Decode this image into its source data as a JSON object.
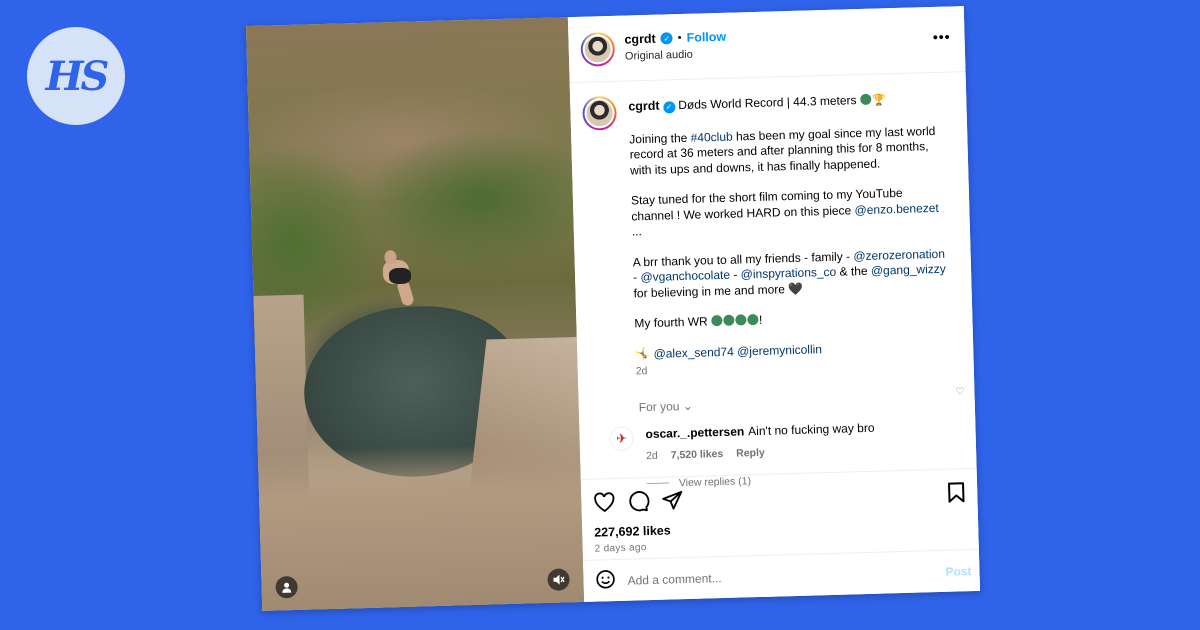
{
  "brand": {
    "logo_text": "HS"
  },
  "post": {
    "username": "cgrdt",
    "follow_label": "Follow",
    "separator": "•",
    "audio": "Original audio",
    "more_label": "•••",
    "caption": {
      "title": "Døds World Record | 44.3 meters",
      "p1_pre": "Joining the ",
      "p1_hashtag": "#40club",
      "p1_post": " has been my goal since my last world record at 36 meters and after planning this for 8 months, with its ups and downs, it has finally happened.",
      "p2_pre": "Stay tuned for the short film coming to my YouTube channel ! We worked HARD on this piece ",
      "p2_mention": "@enzo.benezet",
      "p2_post": " ...",
      "p3_pre": "A brr thank you to all my friends - family - ",
      "p3_m1": "@zerozeronation",
      "p3_sep1": " - ",
      "p3_m2": "@vganchocolate",
      "p3_sep2": " - ",
      "p3_m3": "@inspyrations_co",
      "p3_and": " & the ",
      "p3_m4": "@gang_wizzy",
      "p3_post": " for believing in me and more ",
      "p4_pre": "My fourth WR ",
      "p4_post": "!",
      "tag1": "@alex_send74",
      "tag2": "@jeremynicollin",
      "time": "2d"
    },
    "for_you": "For you",
    "comment": {
      "username": "oscar._.pettersen",
      "text": "Ain't no fucking way bro",
      "time": "2d",
      "likes": "7,520 likes",
      "reply": "Reply",
      "view_replies": "View replies (1)"
    },
    "likes": "227,692 likes",
    "ago": "2 days ago",
    "add_comment_placeholder": "Add a comment...",
    "post_label": "Post"
  },
  "colors": {
    "background": "#2f63e9",
    "link": "#00376b",
    "follow": "#0095f6"
  },
  "icons": [
    "heart-icon",
    "comment-icon",
    "share-icon",
    "bookmark-icon",
    "emoji-icon",
    "verified-icon",
    "mute-icon",
    "user-icon"
  ]
}
